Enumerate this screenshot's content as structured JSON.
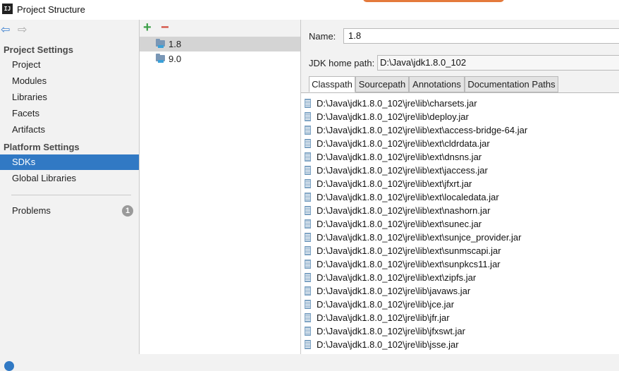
{
  "window": {
    "title": "Project Structure",
    "app_icon": "IJ"
  },
  "nav": {
    "back_icon": "arrow-left-icon",
    "forward_icon": "arrow-right-icon"
  },
  "sidebar": {
    "project_settings_header": "Project Settings",
    "project_items": [
      "Project",
      "Modules",
      "Libraries",
      "Facets",
      "Artifacts"
    ],
    "platform_settings_header": "Platform Settings",
    "platform_items": [
      "SDKs",
      "Global Libraries"
    ],
    "selected_item": "SDKs",
    "problems_label": "Problems",
    "problems_count": "1"
  },
  "sdk_list": {
    "add_label": "+",
    "remove_label": "−",
    "items": [
      "1.8",
      "9.0"
    ],
    "selected": "1.8"
  },
  "details": {
    "name_label": "Name:",
    "name_value": "1.8",
    "jdk_home_label": "JDK home path:",
    "jdk_home_value": "D:\\Java\\jdk1.8.0_102",
    "tabs": [
      "Classpath",
      "Sourcepath",
      "Annotations",
      "Documentation Paths"
    ],
    "active_tab": "Classpath",
    "classpath": [
      "D:\\Java\\jdk1.8.0_102\\jre\\lib\\charsets.jar",
      "D:\\Java\\jdk1.8.0_102\\jre\\lib\\deploy.jar",
      "D:\\Java\\jdk1.8.0_102\\jre\\lib\\ext\\access-bridge-64.jar",
      "D:\\Java\\jdk1.8.0_102\\jre\\lib\\ext\\cldrdata.jar",
      "D:\\Java\\jdk1.8.0_102\\jre\\lib\\ext\\dnsns.jar",
      "D:\\Java\\jdk1.8.0_102\\jre\\lib\\ext\\jaccess.jar",
      "D:\\Java\\jdk1.8.0_102\\jre\\lib\\ext\\jfxrt.jar",
      "D:\\Java\\jdk1.8.0_102\\jre\\lib\\ext\\localedata.jar",
      "D:\\Java\\jdk1.8.0_102\\jre\\lib\\ext\\nashorn.jar",
      "D:\\Java\\jdk1.8.0_102\\jre\\lib\\ext\\sunec.jar",
      "D:\\Java\\jdk1.8.0_102\\jre\\lib\\ext\\sunjce_provider.jar",
      "D:\\Java\\jdk1.8.0_102\\jre\\lib\\ext\\sunmscapi.jar",
      "D:\\Java\\jdk1.8.0_102\\jre\\lib\\ext\\sunpkcs11.jar",
      "D:\\Java\\jdk1.8.0_102\\jre\\lib\\ext\\zipfs.jar",
      "D:\\Java\\jdk1.8.0_102\\jre\\lib\\javaws.jar",
      "D:\\Java\\jdk1.8.0_102\\jre\\lib\\jce.jar",
      "D:\\Java\\jdk1.8.0_102\\jre\\lib\\jfr.jar",
      "D:\\Java\\jdk1.8.0_102\\jre\\lib\\jfxswt.jar",
      "D:\\Java\\jdk1.8.0_102\\jre\\lib\\jsse.jar"
    ]
  },
  "colors": {
    "selection": "#3179c4",
    "add": "#3ea04a",
    "remove": "#d24a3c"
  }
}
